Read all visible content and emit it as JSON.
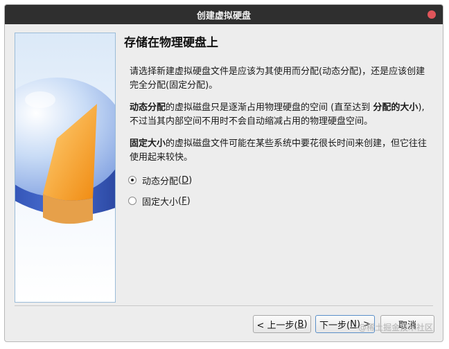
{
  "window": {
    "title": "创建虚拟硬盘"
  },
  "page": {
    "heading": "存储在物理硬盘上",
    "intro": "请选择新建虚拟硬盘文件是应该为其使用而分配(动态分配)，还是应该创建完全分配(固定分配)。",
    "dynamic": {
      "bold_term": "动态分配",
      "text_a": "的虚拟磁盘只是逐渐占用物理硬盘的空间 (直至达到 ",
      "bold_size": "分配的大小",
      "text_b": "), 不过当其内部空间不用时不会自动缩减占用的物理硬盘空间。"
    },
    "fixed": {
      "bold_term": "固定大小",
      "text": "的虚拟磁盘文件可能在某些系统中要花很长时间来创建，但它往往使用起来较快。"
    },
    "options": [
      {
        "label": "动态分配",
        "mnemonic": "D",
        "checked": true
      },
      {
        "label": "固定大小",
        "mnemonic": "F",
        "checked": false
      }
    ]
  },
  "buttons": {
    "back": {
      "prefix": "< 上一步(",
      "mnemonic": "B",
      "suffix": ")"
    },
    "next": {
      "prefix": "下一步(",
      "mnemonic": "N",
      "suffix": ") >"
    },
    "cancel": "取消"
  },
  "watermark": "@稀土掘金技术社区"
}
